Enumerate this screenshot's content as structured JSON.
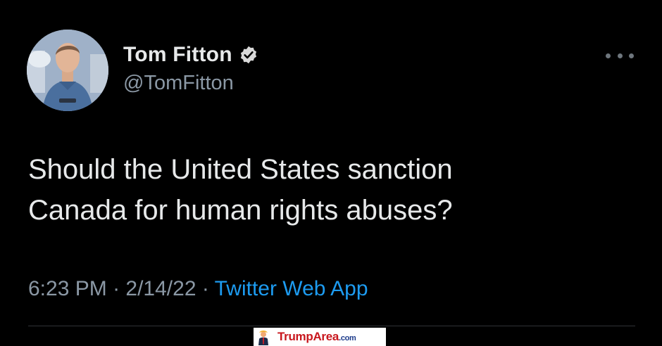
{
  "author": {
    "display_name": "Tom Fitton",
    "handle": "@TomFitton",
    "verified": true
  },
  "tweet": {
    "text_line1": "Should the United States sanction",
    "text_line2": "Canada for human rights abuses?"
  },
  "meta": {
    "time": "6:23 PM",
    "separator1": " · ",
    "date": "2/14/22",
    "separator2": " · ",
    "source": "Twitter Web App"
  },
  "watermark": {
    "brand_part1": "Trump",
    "brand_part2": "Area",
    "brand_suffix": ".com"
  },
  "icons": {
    "more": "more-horizontal-icon",
    "verified": "verified-badge-icon"
  },
  "colors": {
    "background": "#000000",
    "text": "#e7e9ea",
    "secondary": "#8b98a5",
    "link": "#1d9bf0",
    "divider": "#2f3336"
  }
}
